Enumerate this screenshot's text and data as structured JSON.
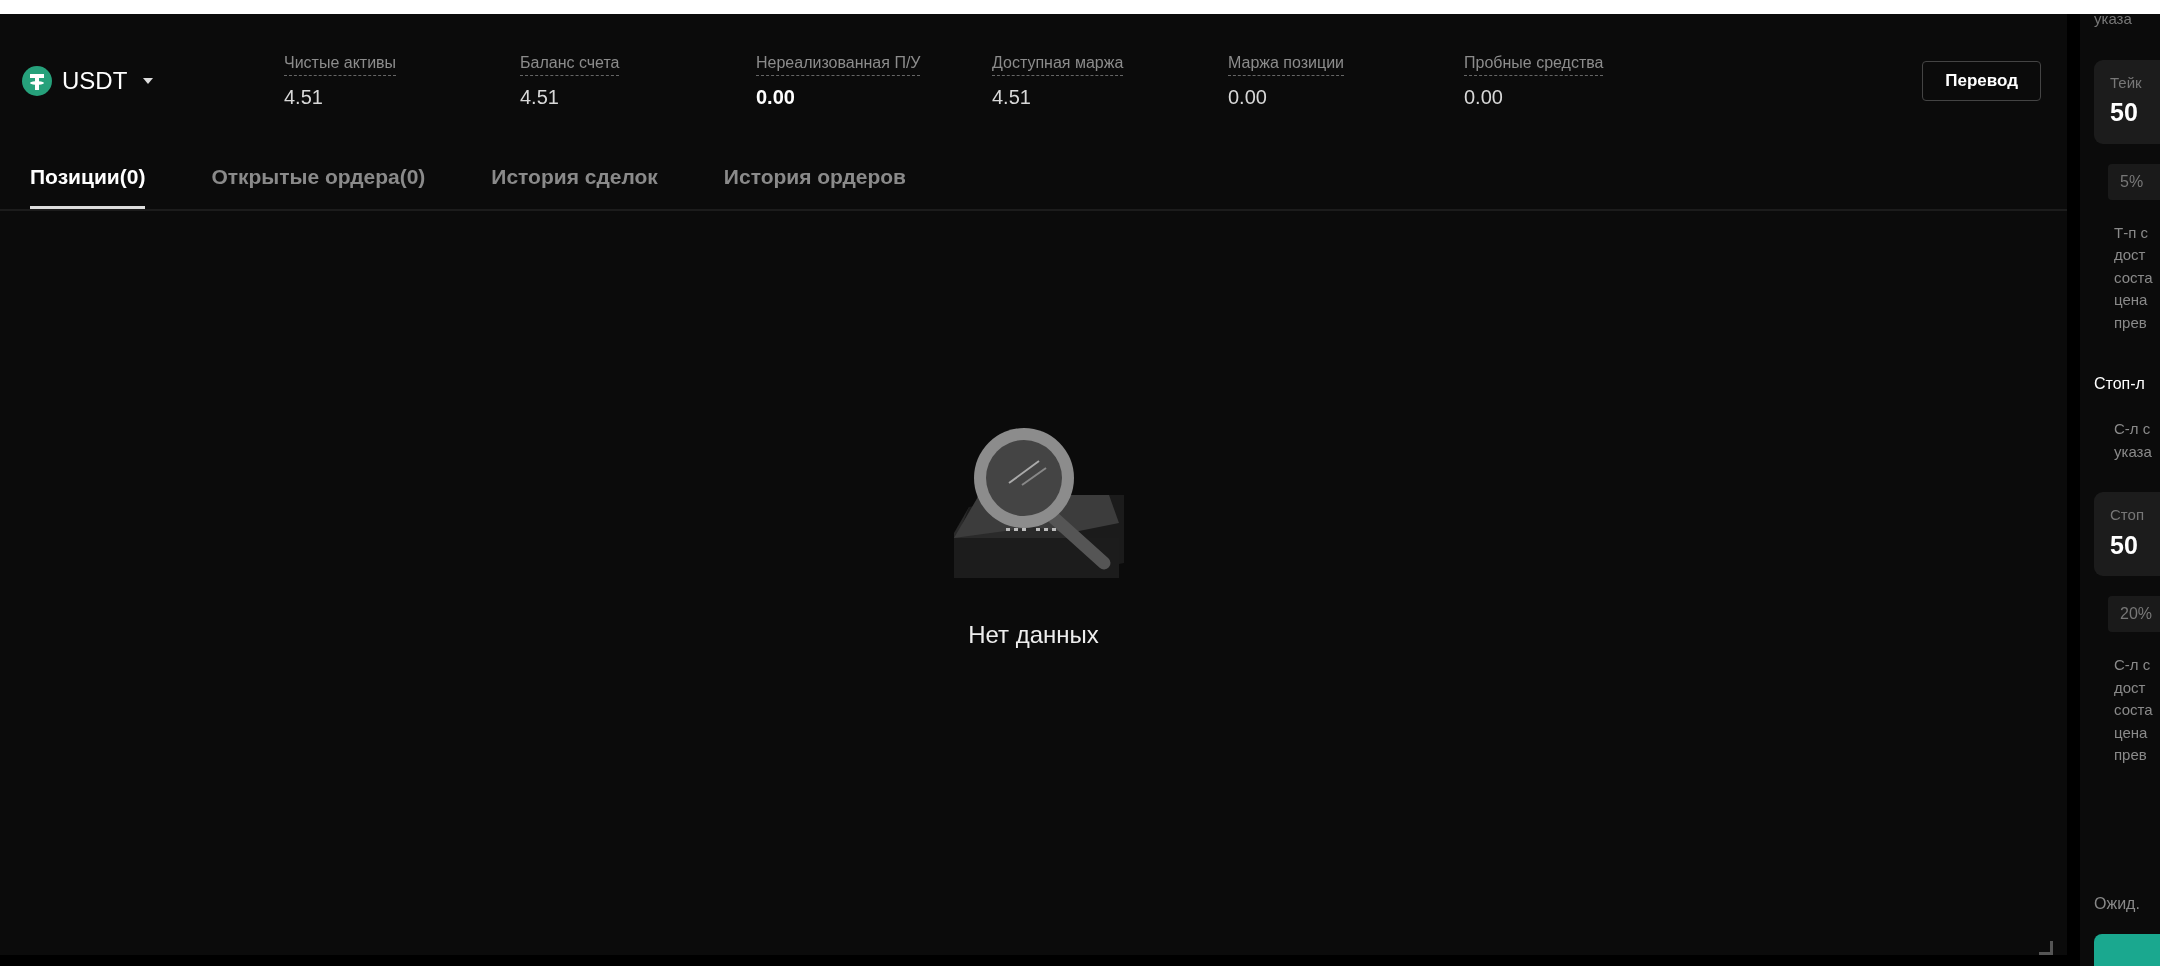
{
  "currency": {
    "name": "USDT"
  },
  "stats": [
    {
      "label": "Чистые активы",
      "value": "4.51",
      "highlighted": false
    },
    {
      "label": "Баланс счета",
      "value": "4.51",
      "highlighted": false
    },
    {
      "label": "Нереализованная П/У",
      "value": "0.00",
      "highlighted": true
    },
    {
      "label": "Доступная маржа",
      "value": "4.51",
      "highlighted": false
    },
    {
      "label": "Маржа позиции",
      "value": "0.00",
      "highlighted": false
    },
    {
      "label": "Пробные средства",
      "value": "0.00",
      "highlighted": false
    }
  ],
  "transfer_button": "Перевод",
  "tabs": [
    {
      "label": "Позиции(0)",
      "selected": true
    },
    {
      "label": "Открытые ордера(0)",
      "selected": false
    },
    {
      "label": "История сделок",
      "selected": false
    },
    {
      "label": "История ордеров",
      "selected": false
    }
  ],
  "empty_state": {
    "text": "Нет данных"
  },
  "side_panel": {
    "items": [
      {
        "kind": "hint",
        "text": "указа"
      },
      {
        "kind": "field",
        "label": "Тейк",
        "value": "50"
      },
      {
        "kind": "chip",
        "text": "5%"
      },
      {
        "kind": "note",
        "lines": [
          "Т-п с",
          "дост",
          "соста",
          "цена",
          "прев"
        ]
      },
      {
        "kind": "heading",
        "text": "Стоп-л"
      },
      {
        "kind": "note",
        "lines": [
          "С-л с",
          "указа"
        ]
      },
      {
        "kind": "field",
        "label": "Стоп",
        "value": "50"
      },
      {
        "kind": "chip",
        "text": "20%"
      },
      {
        "kind": "note",
        "lines": [
          "С-л с",
          "дост",
          "соста",
          "цена",
          "прев"
        ]
      },
      {
        "kind": "label",
        "text": "Ожид."
      },
      {
        "kind": "button"
      }
    ]
  }
}
